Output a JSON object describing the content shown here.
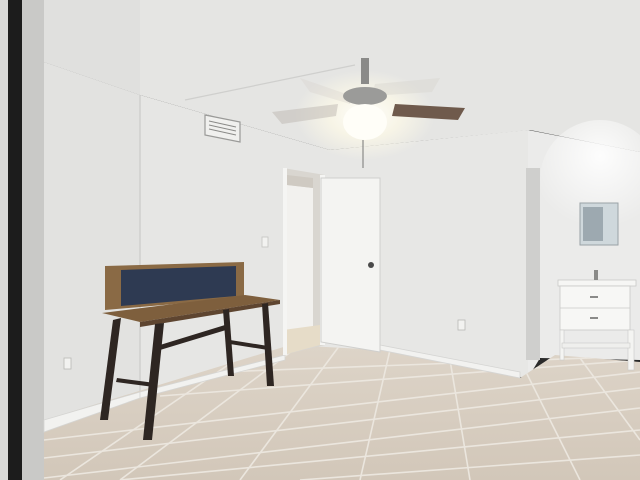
{
  "scene": {
    "kind": "interior-photo",
    "colors": {
      "ceiling": "#e6e6e4",
      "wall": "#e4e4e2",
      "floor": "#d6ccbf",
      "tile_grout": "#ece7df",
      "door": "#f4f4f2",
      "desk_wood": "#8a6a45",
      "desk_legs": "#2e2622",
      "desk_panel": "#2e3a52",
      "fan_blade": "#6f5a4c",
      "light_glow": "#fffdf6"
    }
  }
}
